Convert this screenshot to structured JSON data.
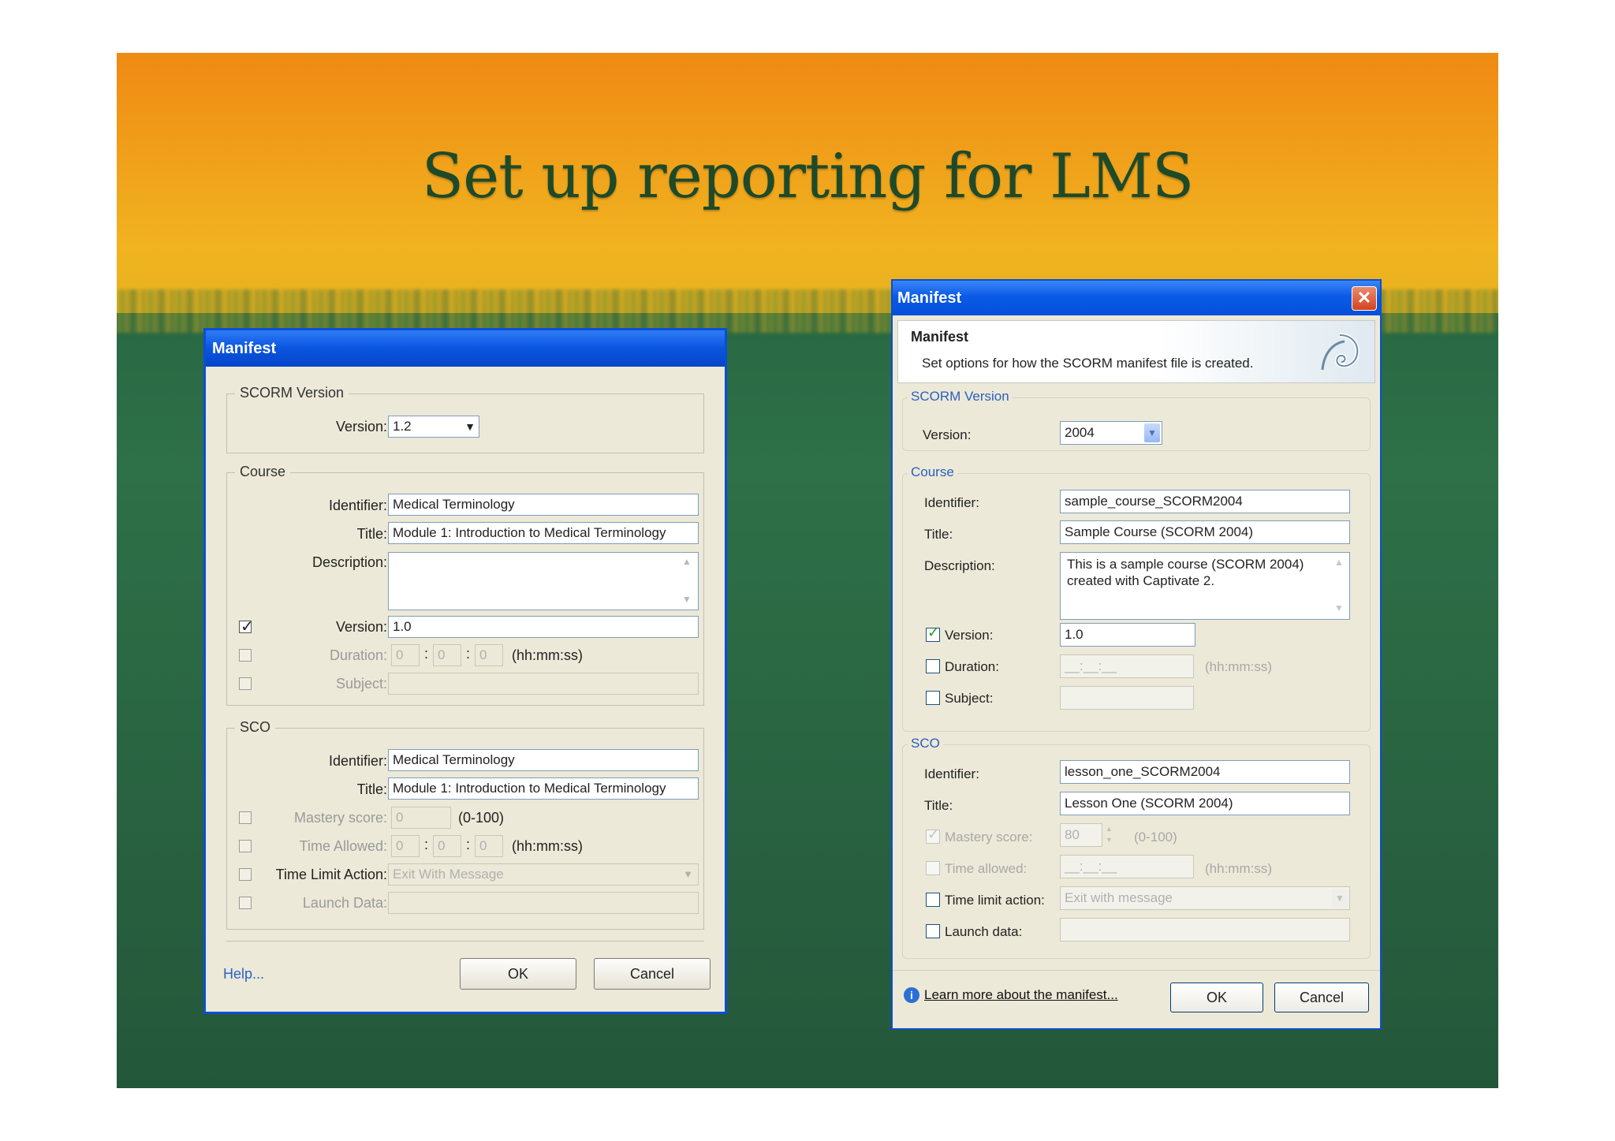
{
  "slide": {
    "title": "Set up reporting for LMS"
  },
  "left_dialog": {
    "title": "Manifest",
    "scorm_group": "SCORM Version",
    "version_label": "Version:",
    "version_value": "1.2",
    "course_group": "Course",
    "identifier_label": "Identifier:",
    "identifier_value": "Medical Terminology",
    "title_label": "Title:",
    "title_value": "Module 1: Introduction to Medical Terminology",
    "description_label": "Description:",
    "description_value": "",
    "course_version_label": "Version:",
    "course_version_value": "1.0",
    "duration_label": "Duration:",
    "duration_h": "0",
    "duration_m": "0",
    "duration_s": "0",
    "time_format": "(hh:mm:ss)",
    "subject_label": "Subject:",
    "subject_value": "",
    "sco_group": "SCO",
    "sco_identifier_label": "Identifier:",
    "sco_identifier_value": "Medical Terminology",
    "sco_title_label": "Title:",
    "sco_title_value": "Module 1: Introduction to Medical Terminology",
    "mastery_label": "Mastery score:",
    "mastery_value": "0",
    "mastery_range": "(0-100)",
    "time_allowed_label": "Time Allowed:",
    "time_allowed_h": "0",
    "time_allowed_m": "0",
    "time_allowed_s": "0",
    "time_limit_label": "Time Limit Action:",
    "time_limit_value": "Exit With Message",
    "launch_label": "Launch Data:",
    "launch_value": "",
    "help_link": "Help...",
    "ok": "OK",
    "cancel": "Cancel"
  },
  "right_dialog": {
    "title": "Manifest",
    "header_title": "Manifest",
    "header_desc": "Set options for how the SCORM manifest file is created.",
    "scorm_group": "SCORM Version",
    "version_label": "Version:",
    "version_value": "2004",
    "course_group": "Course",
    "identifier_label": "Identifier:",
    "identifier_value": "sample_course_SCORM2004",
    "title_label": "Title:",
    "title_value": "Sample Course (SCORM 2004)",
    "description_label": "Description:",
    "description_line1": "This is a sample course  (SCORM 2004)",
    "description_line2": "created with Captivate 2.",
    "course_version_label": "Version:",
    "course_version_value": "1.0",
    "duration_label": "Duration:",
    "duration_value": "__:__:__",
    "time_format": "(hh:mm:ss)",
    "subject_label": "Subject:",
    "sco_group": "SCO",
    "sco_identifier_label": "Identifier:",
    "sco_identifier_value": "lesson_one_SCORM2004",
    "sco_title_label": "Title:",
    "sco_title_value": "Lesson One (SCORM 2004)",
    "mastery_label": "Mastery score:",
    "mastery_value": "80",
    "mastery_range": "(0-100)",
    "time_allowed_label": "Time allowed:",
    "time_allowed_value": "__:__:__",
    "time_limit_label": "Time limit action:",
    "time_limit_value": "Exit with message",
    "launch_label": "Launch data:",
    "learn_link": "Learn more about the manifest...",
    "ok": "OK",
    "cancel": "Cancel",
    "close_glyph": "✕"
  },
  "colors": {
    "title_bar": "#0a55e0",
    "group_label_blue": "#2a5fbf",
    "check_green": "#21a121"
  }
}
